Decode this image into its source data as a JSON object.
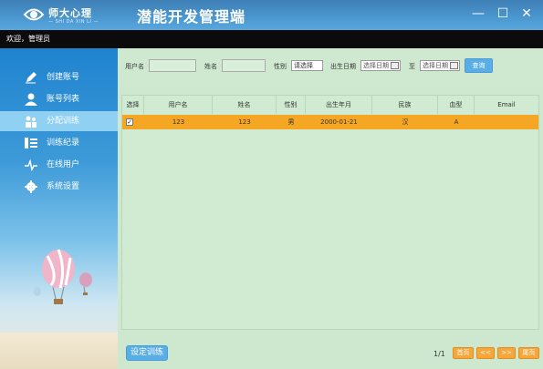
{
  "titlebar": {
    "brand": "师大心理",
    "brand_sub": "— SHI DA XIN LI —",
    "app_title": "潜能开发管理端",
    "minimize": "—",
    "maximize": "☐",
    "close": "✕"
  },
  "welcome": "欢迎，管理员",
  "sidebar": {
    "items": [
      {
        "label": "创建账号",
        "icon": "pencil-icon",
        "active": false
      },
      {
        "label": "账号列表",
        "icon": "user-icon",
        "active": false
      },
      {
        "label": "分配训练",
        "icon": "users-icon",
        "active": true
      },
      {
        "label": "训练纪录",
        "icon": "list-icon",
        "active": false
      },
      {
        "label": "在线用户",
        "icon": "pulse-icon",
        "active": false
      },
      {
        "label": "系统设置",
        "icon": "gear-icon",
        "active": false
      }
    ]
  },
  "filters": {
    "username_label": "用户名",
    "name_label": "姓名",
    "gender_label": "性别",
    "gender_value": "请选择",
    "birth_label": "出生日期",
    "date_from": "选择日期",
    "to_label": "至",
    "date_to": "选择日期",
    "search_button": "查询"
  },
  "table": {
    "headers": [
      "选择",
      "用户名",
      "姓名",
      "性别",
      "出生年月",
      "民族",
      "血型",
      "Email"
    ],
    "rows": [
      {
        "selected": "✓",
        "username": "123",
        "name": "123",
        "gender": "男",
        "birth": "2000-01-21",
        "ethnicity": "汉",
        "blood": "A",
        "email": ""
      }
    ]
  },
  "footer": {
    "set_training_button": "设定训练",
    "page_info": "1/1",
    "first": "首页",
    "prev": "<<",
    "next": ">>",
    "last": "尾页"
  },
  "colors": {
    "accent": "#5aaee6",
    "row_highlight": "#f5a623",
    "page_button": "#f6a63b"
  }
}
